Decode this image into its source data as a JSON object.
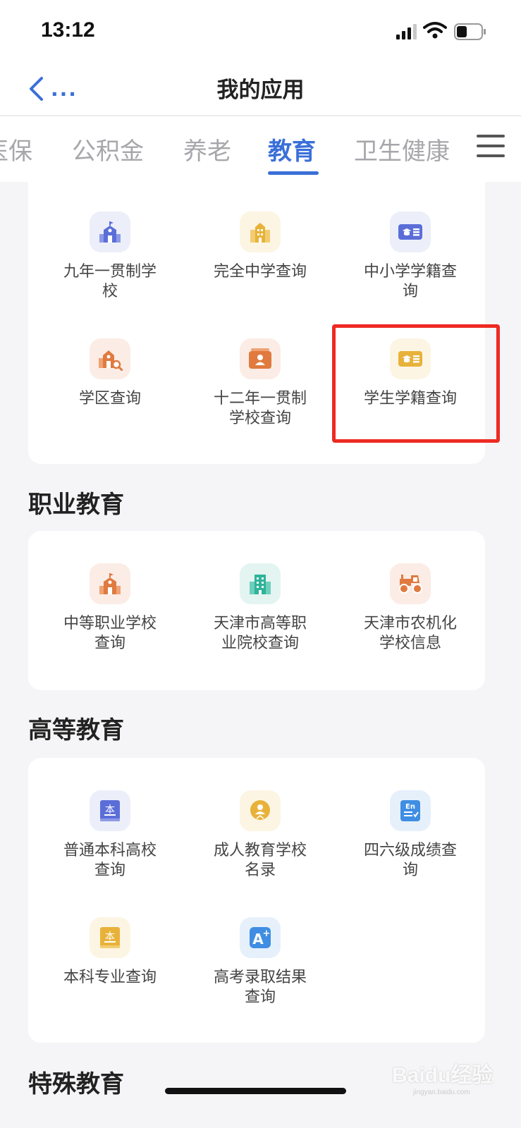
{
  "status_bar": {
    "time": "13:12"
  },
  "nav": {
    "title": "我的应用",
    "back_more": "..."
  },
  "tabs": [
    {
      "label": "医保"
    },
    {
      "label": "公积金"
    },
    {
      "label": "养老"
    },
    {
      "label": "教育"
    },
    {
      "label": "卫生健康"
    }
  ],
  "active_tab": "教育",
  "basic_education": {
    "items": [
      {
        "label": "九年一贯制学校",
        "icon": "school-icon"
      },
      {
        "label": "完全中学查询",
        "icon": "building-icon"
      },
      {
        "label": "中小学学籍查询",
        "icon": "student-card-icon"
      },
      {
        "label": "学区查询",
        "icon": "school-search-icon"
      },
      {
        "label": "十二年一贯制学校查询",
        "icon": "profile-card-icon"
      },
      {
        "label": "学生学籍查询",
        "icon": "student-card-icon"
      }
    ]
  },
  "vocational": {
    "title": "职业教育",
    "items": [
      {
        "label": "中等职业学校查询",
        "icon": "school-icon"
      },
      {
        "label": "天津市高等职业院校查询",
        "icon": "building-icon"
      },
      {
        "label": "天津市农机化学校信息",
        "icon": "tractor-icon"
      }
    ]
  },
  "higher": {
    "title": "高等教育",
    "items": [
      {
        "label": "普通本科高校查询",
        "icon": "book-icon"
      },
      {
        "label": "成人教育学校名录",
        "icon": "person-badge-icon"
      },
      {
        "label": "四六级成绩查询",
        "icon": "english-doc-icon"
      },
      {
        "label": "本科专业查询",
        "icon": "book-icon"
      },
      {
        "label": "高考录取结果查询",
        "icon": "a-plus-icon"
      }
    ]
  },
  "special": {
    "title": "特殊教育"
  },
  "watermark": {
    "brand": "Baidu经验",
    "url": "jingyan.baidu.com"
  },
  "colors": {
    "accent": "#3a6fd8",
    "highlight": "#ee2a23"
  }
}
